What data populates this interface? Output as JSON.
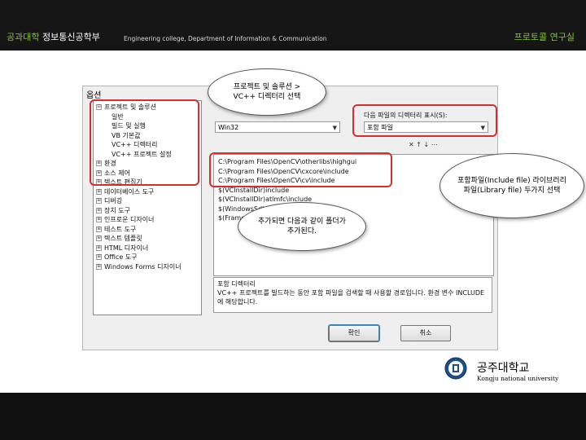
{
  "header": {
    "title_accent": "공과대학",
    "title_main": "정보통신공학부",
    "subtitle": "Engineering college, Department of Information & Communication",
    "lab": "프로토콜 연구실"
  },
  "dialog": {
    "title": "옵션",
    "tree": [
      {
        "label": "프로젝트 및 솔루션",
        "level": 0,
        "toggle": "⊟"
      },
      {
        "label": "일반",
        "level": 1
      },
      {
        "label": "빌드 및 실행",
        "level": 1
      },
      {
        "label": "VB 기본값",
        "level": 1
      },
      {
        "label": "VC++ 디렉터리",
        "level": 1
      },
      {
        "label": "VC++ 프로젝트 설정",
        "level": 1
      },
      {
        "label": "환경",
        "level": 0,
        "toggle": "⊞"
      },
      {
        "label": "소스 제어",
        "level": 0,
        "toggle": "⊞"
      },
      {
        "label": "텍스트 편집기",
        "level": 0,
        "toggle": "⊞"
      },
      {
        "label": "데이터베이스 도구",
        "level": 0,
        "toggle": "⊞"
      },
      {
        "label": "디버깅",
        "level": 0,
        "toggle": "⊞"
      },
      {
        "label": "장치 도구",
        "level": 0,
        "toggle": "⊞"
      },
      {
        "label": "인프로운 디자이너",
        "level": 0,
        "toggle": "⊞"
      },
      {
        "label": "테스트 도구",
        "level": 0,
        "toggle": "⊞"
      },
      {
        "label": "텍스트 템플릿",
        "level": 0,
        "toggle": "⊞"
      },
      {
        "label": "HTML 디자이너",
        "level": 0,
        "toggle": "⊞"
      },
      {
        "label": "Office 도구",
        "level": 0,
        "toggle": "⊞"
      },
      {
        "label": "Windows Forms 디자이너",
        "level": 0,
        "toggle": "⊞"
      }
    ],
    "platform_value": "Win32",
    "show_dirs_label": "다음 파일의 디렉터리 표시(S):",
    "show_dirs_value": "포함 파일",
    "toolbar_icons": "✕ ↑ ↓ ⋯",
    "directories": [
      "C:\\Program Files\\OpenCV\\otherlibs\\highgui",
      "C:\\Program Files\\OpenCV\\cxcore\\include",
      "C:\\Program Files\\OpenCV\\cv\\include",
      "$(VCInstallDir)include",
      "$(VCInstallDir)atlmfc\\include",
      "$(WindowsSdkDir)include",
      "$(FrameworkSDKDir)include"
    ],
    "desc_title": "포함 디렉터리",
    "desc_text": "VC++ 프로젝트를 빌드하는 동안 포함 파일을 검색할 때 사용할 경로입니다. 환경 변수 INCLUDE에 해당합니다.",
    "ok_label": "확인",
    "cancel_label": "취소"
  },
  "callouts": {
    "top": "프로젝트 및 솔루션 > VC++ 디렉터리 선택",
    "right": "포함파일(Include file) 라이브러리 파일(Library file) 두가지 선택",
    "middle": "추가되면 다음과 같이 폴더가 추가된다."
  },
  "university": {
    "name": "공주대학교",
    "english": "Kongju national university"
  },
  "colors": {
    "accent_green": "#86c33a",
    "highlight_red": "#d62e2e"
  }
}
